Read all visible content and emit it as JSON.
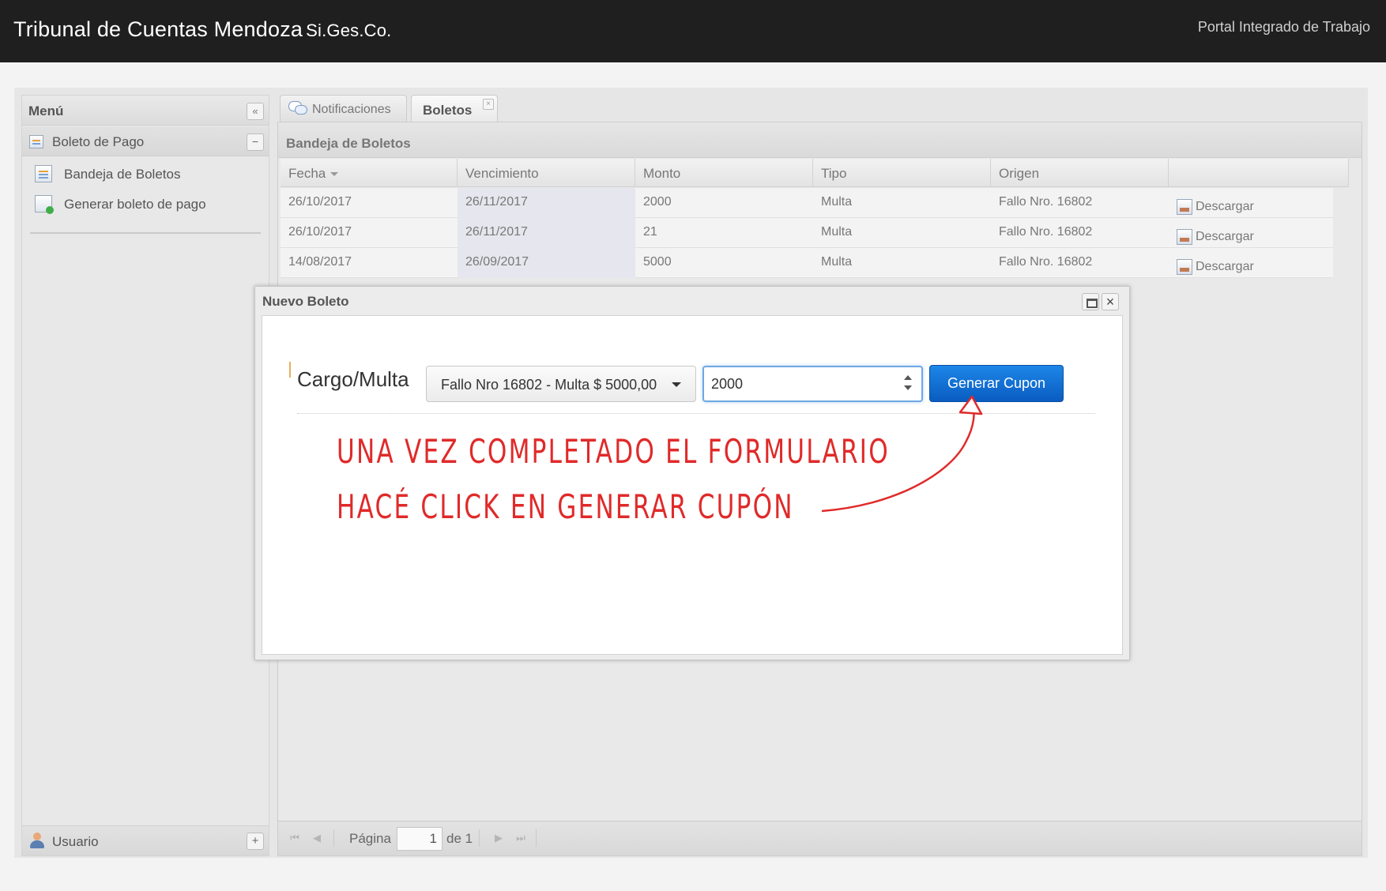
{
  "header": {
    "title": "Tribunal de Cuentas Mendoza",
    "subtitle": "Si.Ges.Co.",
    "portal": "Portal Integrado de Trabajo"
  },
  "menu": {
    "title": "Menú",
    "collapse_glyph": "«",
    "section": {
      "label": "Boleto de Pago",
      "toggle_glyph": "−"
    },
    "items": [
      {
        "label": "Bandeja de Boletos",
        "icon": "grid-icon"
      },
      {
        "label": "Generar boleto de pago",
        "icon": "new-document-icon"
      }
    ],
    "footer": {
      "label": "Usuario",
      "toggle_glyph": "+"
    }
  },
  "tabs": [
    {
      "label": "Notificaciones",
      "active": false
    },
    {
      "label": "Boletos",
      "active": true,
      "close_glyph": "×"
    }
  ],
  "grid": {
    "title": "Bandeja de Boletos",
    "columns": [
      "Fecha",
      "Vencimiento",
      "Monto",
      "Tipo",
      "Origen",
      ""
    ],
    "rows": [
      {
        "fecha": "26/10/2017",
        "vencimiento": "26/11/2017",
        "monto": "2000",
        "tipo": "Multa",
        "origen": "Fallo Nro. 16802",
        "action": "Descargar"
      },
      {
        "fecha": "26/10/2017",
        "vencimiento": "26/11/2017",
        "monto": "21",
        "tipo": "Multa",
        "origen": "Fallo Nro. 16802",
        "action": "Descargar"
      },
      {
        "fecha": "14/08/2017",
        "vencimiento": "26/09/2017",
        "monto": "5000",
        "tipo": "Multa",
        "origen": "Fallo Nro. 16802",
        "action": "Descargar"
      }
    ]
  },
  "pager": {
    "label": "Página",
    "page": "1",
    "of_label": "de 1",
    "first_glyph": "⏮",
    "prev_glyph": "◀",
    "next_glyph": "▶",
    "last_glyph": "⏭"
  },
  "dialog": {
    "title": "Nuevo Boleto",
    "close_glyph": "×",
    "field_label": "Cargo/Multa",
    "select_value": "Fallo Nro 16802 - Multa $ 5000,00",
    "amount_value": "2000",
    "button_label": "Generar Cupon",
    "hint_line1": "UNA VEZ COMPLETADO EL FORMULARIO",
    "hint_line2": "HACÉ CLICK EN GENERAR CUPÓN"
  },
  "colors": {
    "header_bg": "#1f1f1f",
    "button_blue": "#0a5cc0",
    "annotation_red": "#e02a2a"
  }
}
